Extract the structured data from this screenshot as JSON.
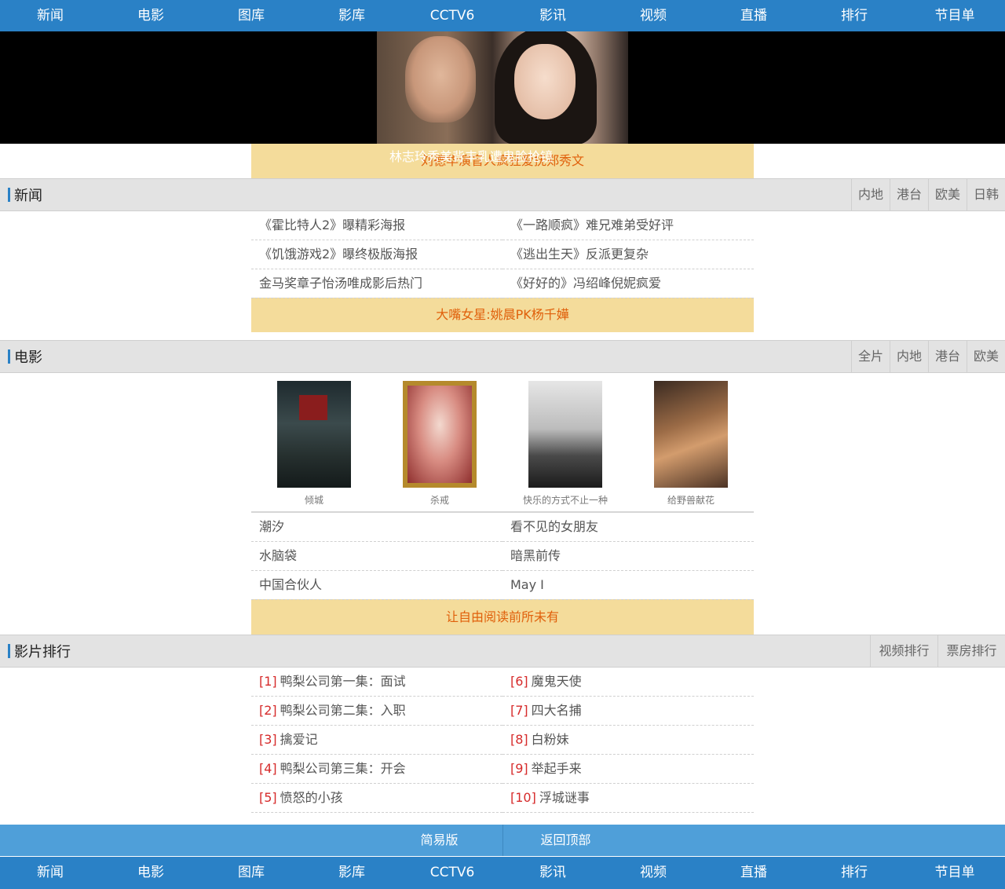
{
  "nav": [
    "新闻",
    "电影",
    "图库",
    "影库",
    "CCTV6",
    "影讯",
    "视频",
    "直播",
    "排行",
    "节目单"
  ],
  "hero": {
    "caption": "林志玲秀美背丰乳遭鬼脸抢镜"
  },
  "banners": [
    "刘德华演盲人疯狂爱抚郑秀文",
    "大嘴女星:姚晨PK杨千嬅",
    "让自由阅读前所未有"
  ],
  "news": {
    "title": "新闻",
    "tabs": [
      "内地",
      "港台",
      "欧美",
      "日韩"
    ],
    "items": [
      "《霍比特人2》曝精彩海报",
      "《一路顺疯》难兄难弟受好评",
      "《饥饿游戏2》曝终极版海报",
      "《逃出生天》反派更复杂",
      "金马奖章子怡汤唯成影后热门",
      "《好好的》冯绍峰倪妮疯爱"
    ]
  },
  "movies": {
    "title": "电影",
    "tabs": [
      "全片",
      "内地",
      "港台",
      "欧美"
    ],
    "posters": [
      {
        "name": "倾城",
        "icon": "poster-image"
      },
      {
        "name": "杀戒",
        "icon": "poster-image"
      },
      {
        "name": "快乐的方式不止一种",
        "icon": "poster-image"
      },
      {
        "name": "给野兽献花",
        "icon": "poster-image"
      }
    ],
    "items": [
      "潮汐",
      "看不见的女朋友",
      "水脑袋",
      "暗黑前传",
      "中国合伙人",
      "May I"
    ]
  },
  "ranking": {
    "title": "影片排行",
    "tabs": [
      "视频排行",
      "票房排行"
    ],
    "items": [
      {
        "rank": "[1]",
        "name": "鸭梨公司第一集：面试"
      },
      {
        "rank": "[6]",
        "name": "魔鬼天使"
      },
      {
        "rank": "[2]",
        "name": "鸭梨公司第二集：入职"
      },
      {
        "rank": "[7]",
        "name": "四大名捕"
      },
      {
        "rank": "[3]",
        "name": "擒爱记"
      },
      {
        "rank": "[8]",
        "name": "白粉妹"
      },
      {
        "rank": "[4]",
        "name": "鸭梨公司第三集：开会"
      },
      {
        "rank": "[9]",
        "name": "举起手来"
      },
      {
        "rank": "[5]",
        "name": "愤怒的小孩"
      },
      {
        "rank": "[10]",
        "name": "浮城谜事"
      }
    ]
  },
  "footer": {
    "simple": "简易版",
    "top": "返回顶部"
  },
  "colors": {
    "nav": "#2a81c6",
    "footer": "#4f9fd9",
    "banner_bg": "#f4dc9b",
    "banner_text": "#e0600b",
    "rank": "#d62b2b"
  }
}
